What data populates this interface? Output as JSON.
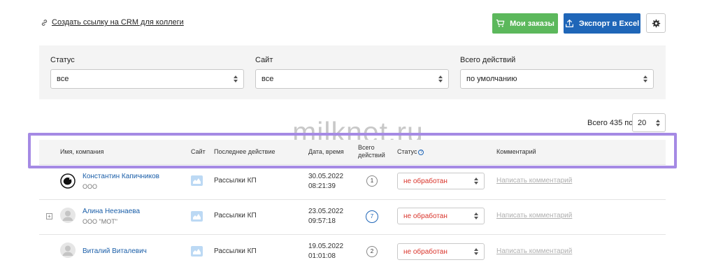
{
  "top": {
    "crm_link_label": "Создать ссылку на CRM для коллеги",
    "my_orders_label": "Мои заказы",
    "export_label": "Экспорт в Excel"
  },
  "filters": [
    {
      "label": "Статус",
      "value": "все"
    },
    {
      "label": "Сайт",
      "value": "все"
    },
    {
      "label": "Всего действий",
      "value": "по умолчанию"
    }
  ],
  "pagination": {
    "total_label": "Всего 435 по",
    "per_page": "20"
  },
  "watermark": "milknet.ru",
  "table": {
    "headers": {
      "name": "Имя, компания",
      "site": "Сайт",
      "last_action": "Последнее действие",
      "datetime": "Дата, время",
      "total_actions": "Всего действий",
      "status": "Статус",
      "comment": "Комментарий"
    },
    "rows": [
      {
        "name": "Константин Капичников",
        "company": "ООО",
        "action": "Рассылки КП",
        "date": "30.05.2022",
        "time": "08:21:39",
        "total": "1",
        "status": "не обработан",
        "comment": "Написать комментарий"
      },
      {
        "name": "Алина Неезнаева",
        "company": "ООО \"МОТ\"",
        "action": "Рассылки КП",
        "date": "23.05.2022",
        "time": "09:57:18",
        "total": "7",
        "status": "не обработан",
        "comment": "Написать комментарий"
      },
      {
        "name": "Виталий Виталевич",
        "company": "",
        "action": "Рассылки КП",
        "date": "19.05.2022",
        "time": "01:01:08",
        "total": "2",
        "status": "не обработан",
        "comment": "Написать комментарий"
      }
    ]
  },
  "colors": {
    "green": "#5cb85c",
    "blue": "#1f66b8",
    "status_red": "#d9342b",
    "highlight": "#a58ae4"
  }
}
